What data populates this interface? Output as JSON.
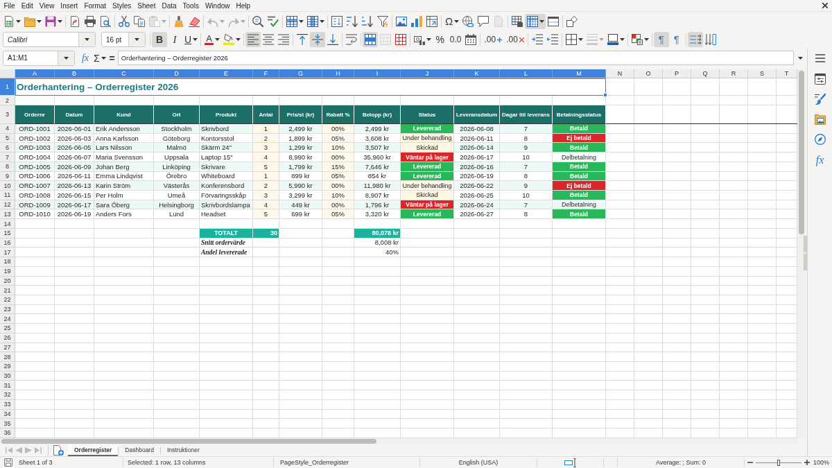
{
  "menu_bar": [
    "File",
    "Edit",
    "View",
    "Insert",
    "Format",
    "Styles",
    "Sheet",
    "Data",
    "Tools",
    "Window",
    "Help"
  ],
  "standard_toolbar": {
    "groups": [
      [
        {
          "kind": "new",
          "on": false,
          "disabled": false
        },
        {
          "kind": "open",
          "on": false,
          "disabled": false
        },
        {
          "kind": "save",
          "on": false,
          "disabled": false
        }
      ],
      [
        {
          "kind": "pdf",
          "on": false,
          "disabled": false
        },
        {
          "kind": "print",
          "on": false,
          "disabled": false
        },
        {
          "kind": "preview",
          "on": false,
          "disabled": false
        }
      ],
      [
        {
          "kind": "cut",
          "on": false,
          "disabled": false
        },
        {
          "kind": "copy",
          "on": false,
          "disabled": false
        },
        {
          "kind": "paste",
          "on": false,
          "disabled": true
        }
      ],
      [
        {
          "kind": "brush",
          "on": false,
          "disabled": false
        },
        {
          "kind": "clear",
          "on": false,
          "disabled": false
        }
      ],
      [
        {
          "kind": "undo",
          "on": false,
          "disabled": true
        },
        {
          "kind": "redo",
          "on": false,
          "disabled": true
        }
      ],
      [
        {
          "kind": "find",
          "on": false,
          "disabled": false
        },
        {
          "kind": "spelling",
          "on": false,
          "disabled": false
        }
      ],
      [
        {
          "kind": "rows",
          "on": false,
          "disabled": false
        },
        {
          "kind": "columns",
          "on": false,
          "disabled": false
        }
      ],
      [
        {
          "kind": "sort",
          "on": false,
          "disabled": false
        },
        {
          "kind": "sortasc",
          "on": false,
          "disabled": false
        },
        {
          "kind": "sortdesc",
          "on": false,
          "disabled": false
        },
        {
          "kind": "filter",
          "on": false,
          "disabled": false
        }
      ],
      [
        {
          "kind": "image",
          "on": false,
          "disabled": false
        },
        {
          "kind": "chart",
          "on": false,
          "disabled": false
        },
        {
          "kind": "pivot",
          "on": false,
          "disabled": false
        }
      ],
      [
        {
          "kind": "special",
          "glyph": "Ω",
          "on": false,
          "disabled": false
        },
        {
          "kind": "link",
          "on": false,
          "disabled": false
        },
        {
          "kind": "comment",
          "on": false,
          "disabled": false
        },
        {
          "kind": "headerfooter",
          "on": false,
          "disabled": true
        }
      ],
      [
        {
          "kind": "printarea",
          "on": false,
          "disabled": false
        },
        {
          "kind": "freeze",
          "on": true,
          "disabled": false
        },
        {
          "kind": "split",
          "on": false,
          "disabled": false
        }
      ],
      [
        {
          "kind": "shapes",
          "on": false,
          "disabled": false
        }
      ]
    ]
  },
  "formatting_toolbar": {
    "font_name": "Calibri",
    "font_size": "16 pt",
    "groups": [
      [
        {
          "kind": "bold",
          "glyph": "B",
          "on": true,
          "disabled": false
        },
        {
          "kind": "italic",
          "glyph": "I",
          "on": false,
          "disabled": false
        },
        {
          "kind": "underline",
          "glyph": "U",
          "on": false,
          "disabled": false
        }
      ],
      [
        {
          "kind": "fontcolor",
          "glyph": "A",
          "on": false,
          "disabled": false
        },
        {
          "kind": "highlight",
          "on": false,
          "disabled": false
        }
      ],
      [
        {
          "kind": "alignleft",
          "on": true,
          "disabled": false
        },
        {
          "kind": "aligncenter",
          "on": false,
          "disabled": false
        },
        {
          "kind": "alignright",
          "on": false,
          "disabled": false
        }
      ],
      [
        {
          "kind": "aligntop",
          "on": false,
          "disabled": false
        },
        {
          "kind": "alignmiddle",
          "on": true,
          "disabled": false
        },
        {
          "kind": "alignbottom",
          "on": false,
          "disabled": false
        }
      ],
      [
        {
          "kind": "wrap",
          "on": false,
          "disabled": false
        }
      ],
      [
        {
          "kind": "mergecenter",
          "on": true,
          "disabled": false
        },
        {
          "kind": "merge",
          "on": false,
          "disabled": true
        },
        {
          "kind": "unmerge",
          "on": false,
          "disabled": false
        }
      ],
      [
        {
          "kind": "currency",
          "on": false,
          "disabled": false
        },
        {
          "kind": "percent",
          "glyph": "%",
          "on": false,
          "disabled": false
        },
        {
          "kind": "number",
          "glyph": "0.0",
          "on": false,
          "disabled": false
        },
        {
          "kind": "date",
          "on": false,
          "disabled": false
        }
      ],
      [
        {
          "kind": "adddecimal",
          "glyph": ".00",
          "on": false,
          "disabled": false
        },
        {
          "kind": "deldecimal",
          "glyph": ".00",
          "on": false,
          "disabled": false
        }
      ],
      [
        {
          "kind": "indent",
          "on": false,
          "disabled": false
        },
        {
          "kind": "outdent",
          "on": false,
          "disabled": false
        }
      ],
      [
        {
          "kind": "borders",
          "on": false,
          "disabled": false
        },
        {
          "kind": "borderstyle",
          "on": false,
          "disabled": true
        },
        {
          "kind": "bordercolor",
          "on": false,
          "disabled": false
        }
      ],
      [
        {
          "kind": "conditional",
          "on": false,
          "disabled": false
        }
      ],
      [
        {
          "kind": "ltr",
          "glyph": "¶",
          "on": true,
          "disabled": false
        },
        {
          "kind": "rtl",
          "glyph": "¶",
          "on": false,
          "disabled": false
        }
      ],
      [
        {
          "kind": "textdirection",
          "on": true,
          "disabled": false
        },
        {
          "kind": "verticaltext",
          "on": false,
          "disabled": false
        }
      ]
    ]
  },
  "formula_bar": {
    "name_box": "A1:M1",
    "wizard_glyph": "fx",
    "sum_glyph": "Σ",
    "equals_glyph": "=",
    "content": "Orderhantering – Orderregister 2026"
  },
  "sidebar": {
    "decks": [
      {
        "kind": "properties"
      },
      {
        "kind": "styles"
      },
      {
        "kind": "gallery"
      },
      {
        "kind": "navigator"
      },
      {
        "kind": "functions",
        "glyph": "fx"
      }
    ]
  },
  "sheet": {
    "column_headers": [
      {
        "label": "A",
        "selected": true
      },
      {
        "label": "B",
        "selected": true
      },
      {
        "label": "C",
        "selected": true
      },
      {
        "label": "D",
        "selected": true
      },
      {
        "label": "E",
        "selected": true
      },
      {
        "label": "F",
        "selected": true
      },
      {
        "label": "G",
        "selected": true
      },
      {
        "label": "H",
        "selected": true
      },
      {
        "label": "I",
        "selected": true
      },
      {
        "label": "J",
        "selected": true
      },
      {
        "label": "K",
        "selected": true
      },
      {
        "label": "L",
        "selected": true
      },
      {
        "label": "M",
        "selected": true
      },
      {
        "label": "N",
        "selected": false
      },
      {
        "label": "O",
        "selected": false
      },
      {
        "label": "P",
        "selected": false
      },
      {
        "label": "Q",
        "selected": false
      },
      {
        "label": "R",
        "selected": false
      },
      {
        "label": "S",
        "selected": false
      },
      {
        "label": "T",
        "selected": false
      }
    ],
    "row_headers": [
      {
        "label": "1",
        "selected": true
      },
      {
        "label": "2",
        "selected": false
      },
      {
        "label": "3",
        "selected": false
      },
      {
        "label": "4",
        "selected": false
      },
      {
        "label": "5",
        "selected": false
      },
      {
        "label": "6",
        "selected": false
      },
      {
        "label": "7",
        "selected": false
      },
      {
        "label": "8",
        "selected": false
      },
      {
        "label": "9",
        "selected": false
      },
      {
        "label": "10",
        "selected": false
      },
      {
        "label": "11",
        "selected": false
      },
      {
        "label": "12",
        "selected": false
      },
      {
        "label": "13",
        "selected": false
      },
      {
        "label": "14",
        "selected": false
      },
      {
        "label": "15",
        "selected": false
      },
      {
        "label": "16",
        "selected": false
      },
      {
        "label": "17",
        "selected": false
      },
      {
        "label": "18",
        "selected": false
      },
      {
        "label": "19",
        "selected": false
      },
      {
        "label": "20",
        "selected": false
      },
      {
        "label": "21",
        "selected": false
      },
      {
        "label": "22",
        "selected": false
      },
      {
        "label": "23",
        "selected": false
      },
      {
        "label": "24",
        "selected": false
      },
      {
        "label": "25",
        "selected": false
      },
      {
        "label": "26",
        "selected": false
      },
      {
        "label": "27",
        "selected": false
      },
      {
        "label": "28",
        "selected": false
      },
      {
        "label": "29",
        "selected": false
      },
      {
        "label": "30",
        "selected": false
      },
      {
        "label": "31",
        "selected": false
      },
      {
        "label": "32",
        "selected": false
      },
      {
        "label": "33",
        "selected": false
      },
      {
        "label": "34",
        "selected": false
      },
      {
        "label": "35",
        "selected": false
      },
      {
        "label": "36",
        "selected": false
      }
    ],
    "title": "Orderhantering – Orderregister 2026",
    "table": {
      "columns": [
        "Ordernr",
        "Datum",
        "Kund",
        "Ort",
        "Produkt",
        "Antal",
        "Pris/st (kr)",
        "Rabatt %",
        "Belopp (kr)",
        "Status",
        "Leveransdatum",
        "Dagar till leverans",
        "Betalningsstatus"
      ],
      "rows": [
        {
          "cells": [
            "ORD-1001",
            "2026-06-01",
            "Erik Andersson",
            "Stockholm",
            "Skrivbord",
            "1",
            "2,499 kr",
            "00%",
            "2,499 kr"
          ],
          "status": {
            "text": "Levererad",
            "color": "#28b85a"
          },
          "delivery_date": "2026-06-08",
          "days_to_delivery": "7",
          "payment": {
            "text": "Betald",
            "color": "#28b85a"
          }
        },
        {
          "cells": [
            "ORD-1002",
            "2026-06-03",
            "Anna Karlsson",
            "Göteborg",
            "Kontorsstol",
            "2",
            "1,899 kr",
            "05%",
            "3,608 kr"
          ],
          "status": {
            "text": "Under behandling",
            "color": "#fdf6e3"
          },
          "delivery_date": "2026-06-11",
          "days_to_delivery": "8",
          "payment": {
            "text": "Ej betald",
            "color": "#d9262b"
          }
        },
        {
          "cells": [
            "ORD-1003",
            "2026-06-05",
            "Lars Nilsson",
            "Malmö",
            "Skärm 24\"",
            "3",
            "1,299 kr",
            "10%",
            "3,507 kr"
          ],
          "status": {
            "text": "Skickad",
            "color": "#fdf6e3"
          },
          "delivery_date": "2026-06-14",
          "days_to_delivery": "9",
          "payment": {
            "text": "Betald",
            "color": "#28b85a"
          }
        },
        {
          "cells": [
            "ORD-1004",
            "2026-06-07",
            "Maria Svensson",
            "Uppsala",
            "Laptop 15\"",
            "4",
            "8,990 kr",
            "00%",
            "35,960 kr"
          ],
          "status": {
            "text": "Väntar på lager",
            "color": "#d9262b"
          },
          "delivery_date": "2026-06-17",
          "days_to_delivery": "10",
          "payment": {
            "text": "Delbetalning"
          }
        },
        {
          "cells": [
            "ORD-1005",
            "2026-06-09",
            "Johan Berg",
            "Linköping",
            "Skrivare",
            "5",
            "1,799 kr",
            "15%",
            "7,646 kr"
          ],
          "status": {
            "text": "Levererad",
            "color": "#28b85a"
          },
          "delivery_date": "2026-06-16",
          "days_to_delivery": "7",
          "payment": {
            "text": "Betald",
            "color": "#28b85a"
          }
        },
        {
          "cells": [
            "ORD-1006",
            "2026-06-11",
            "Emma Lindqvist",
            "Örebro",
            "Whiteboard",
            "1",
            "899 kr",
            "05%",
            "854 kr"
          ],
          "status": {
            "text": "Levererad",
            "color": "#28b85a"
          },
          "delivery_date": "2026-06-19",
          "days_to_delivery": "8",
          "payment": {
            "text": "Betald",
            "color": "#28b85a"
          }
        },
        {
          "cells": [
            "ORD-1007",
            "2026-06-13",
            "Karin Ström",
            "Västerås",
            "Konferensbord",
            "2",
            "5,990 kr",
            "00%",
            "11,980 kr"
          ],
          "status": {
            "text": "Under behandling",
            "color": "#fdf6e3"
          },
          "delivery_date": "2026-06-22",
          "days_to_delivery": "9",
          "payment": {
            "text": "Ej betald",
            "color": "#d9262b"
          }
        },
        {
          "cells": [
            "ORD-1008",
            "2026-06-15",
            "Per Holm",
            "Umeå",
            "Förvaringsskåp",
            "3",
            "3,299 kr",
            "10%",
            "8,907 kr"
          ],
          "status": {
            "text": "Skickad",
            "color": "#fdf6e3"
          },
          "delivery_date": "2026-06-25",
          "days_to_delivery": "10",
          "payment": {
            "text": "Betald",
            "color": "#28b85a"
          }
        },
        {
          "cells": [
            "ORD-1009",
            "2026-06-17",
            "Sara Öberg",
            "Helsingborg",
            "Skrivbordslampa",
            "4",
            "449 kr",
            "00%",
            "1,796 kr"
          ],
          "status": {
            "text": "Väntar på lager",
            "color": "#d9262b"
          },
          "delivery_date": "2026-06-24",
          "days_to_delivery": "7",
          "payment": {
            "text": "Delbetalning"
          }
        },
        {
          "cells": [
            "ORD-1010",
            "2026-06-19",
            "Anders Fors",
            "Lund",
            "Headset",
            "5",
            "699 kr",
            "05%",
            "3,320 kr"
          ],
          "status": {
            "text": "Levererad",
            "color": "#28b85a"
          },
          "delivery_date": "2026-06-27",
          "days_to_delivery": "8",
          "payment": {
            "text": "Betald",
            "color": "#28b85a"
          }
        }
      ]
    },
    "summary": [
      {
        "kind": "total",
        "label": "TOTALT",
        "quantity": "30",
        "amount": "80,078 kr"
      },
      {
        "kind": "metric",
        "label": "Snitt ordervärde",
        "amount": "8,008 kr"
      },
      {
        "kind": "metric",
        "label": "Andel levererade",
        "amount": "40%"
      }
    ]
  },
  "sheet_tab_bar": {
    "navigation": [
      {
        "kind": "first",
        "disabled": true
      },
      {
        "kind": "previous",
        "disabled": true
      },
      {
        "kind": "next",
        "disabled": true
      },
      {
        "kind": "last",
        "disabled": true
      }
    ],
    "tabs": [
      {
        "label": "Orderregister",
        "selected": true
      },
      {
        "label": "Dashboard",
        "selected": false
      },
      {
        "label": "Instruktioner",
        "selected": false
      }
    ]
  },
  "status_bar": {
    "sheet_position": "Sheet 1 of 3",
    "selection": "Selected: 1 row, 13 columns",
    "page_style": "PageStyle_Orderregister",
    "language": "English (USA)",
    "calculation": "Average: ; Sum: 0",
    "zoom": {
      "level": 0.5,
      "reading": "100%"
    }
  }
}
